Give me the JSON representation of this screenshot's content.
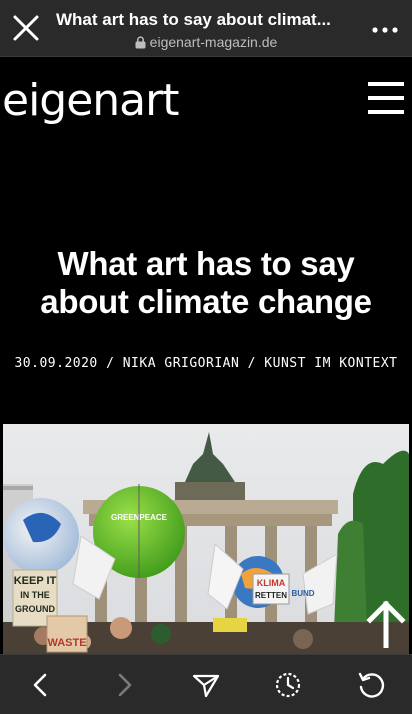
{
  "browser": {
    "page_title": "What art has to say about climat...",
    "domain": "eigenart-magazin.de"
  },
  "site": {
    "logo": "eigenart"
  },
  "article": {
    "headline_line1": "What art has to say",
    "headline_line2": "about climate change",
    "meta": "30.09.2020 / NIKA GRIGORIAN / KUNST IM KONTEXT"
  },
  "photo_signs": {
    "greenpeace": "GREENPEACE",
    "keep_it": "KEEP IT",
    "in_the": "IN THE",
    "ground": "GROUND",
    "klima": "KLIMA",
    "retten": "RETTEN",
    "bund": "BUND",
    "waste": "WASTE"
  },
  "icons": {
    "close": "close-icon",
    "lock": "lock-icon",
    "more": "more-icon",
    "menu": "hamburger-icon",
    "back": "chevron-left-icon",
    "forward": "chevron-right-icon",
    "share": "send-icon",
    "history": "history-icon",
    "reload": "reload-icon",
    "scroll_top": "arrow-up-icon"
  },
  "colors": {
    "toolbar_bg": "#2a2a2a",
    "page_bg": "#000000",
    "text": "#ffffff",
    "muted_text": "#bdbdbd"
  }
}
